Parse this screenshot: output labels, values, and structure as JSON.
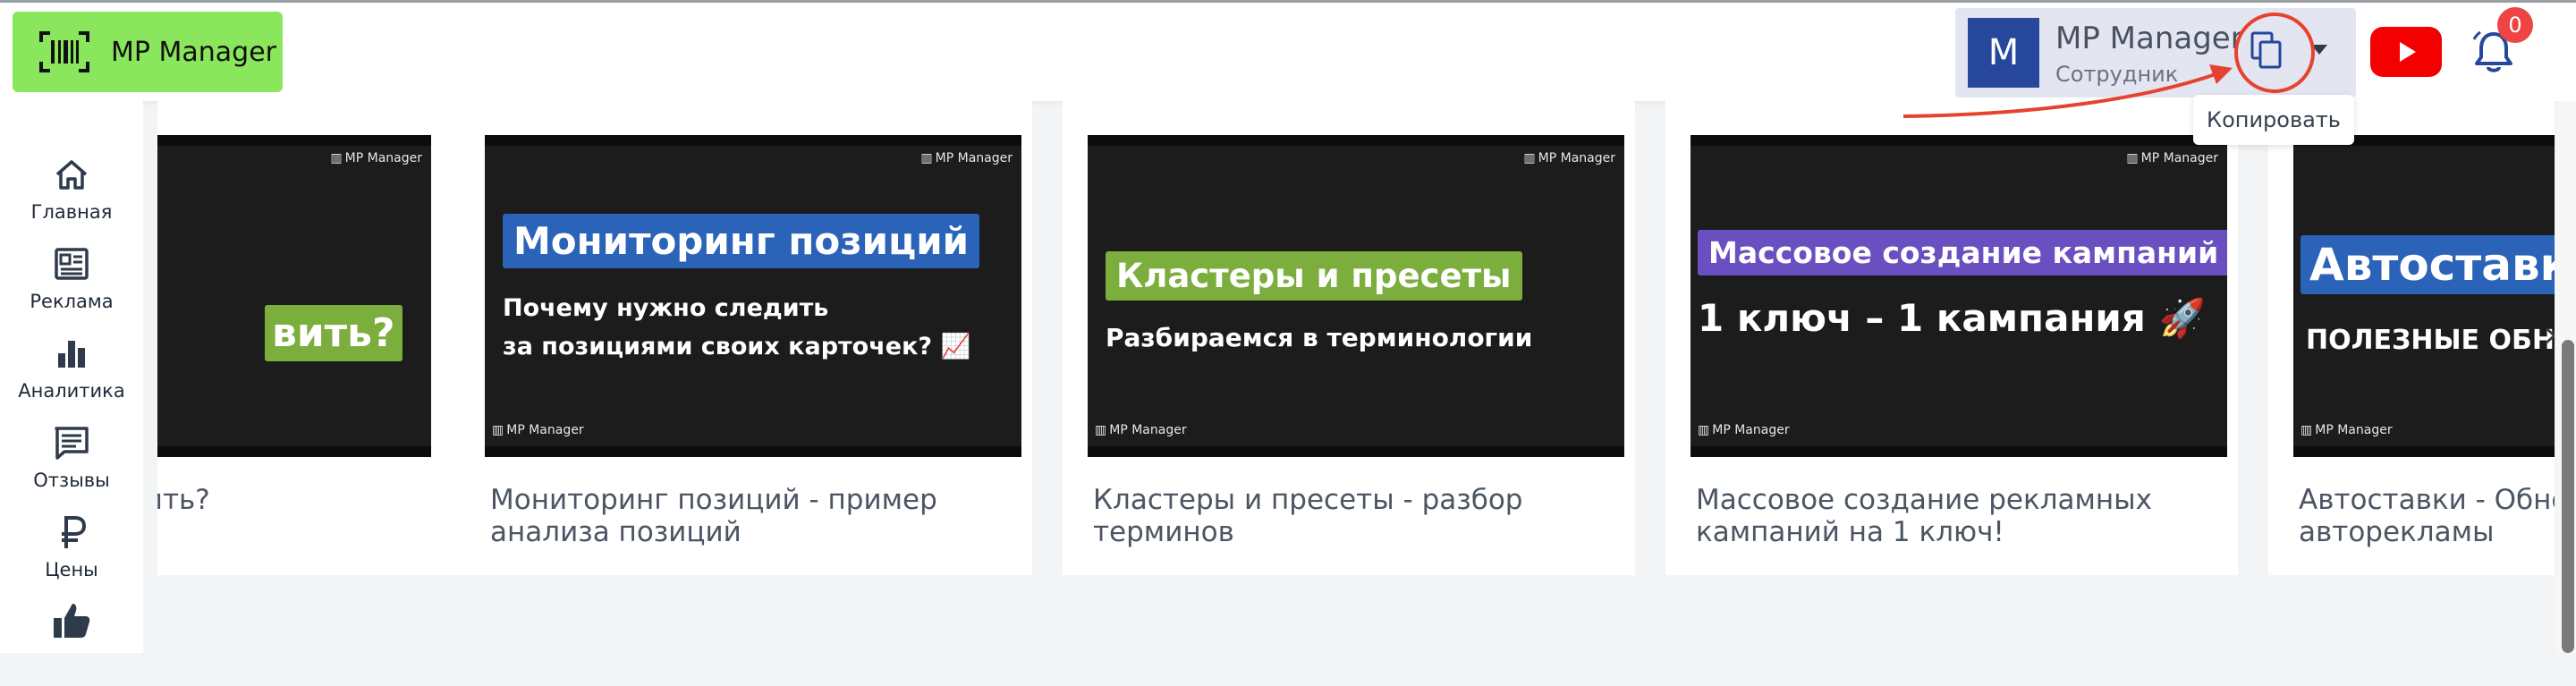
{
  "app": {
    "logo_text": "MP Manager"
  },
  "user": {
    "avatar_letter": "M",
    "name": "MP Manager",
    "role": "Сотрудник"
  },
  "notifications": {
    "count": "0"
  },
  "tooltip": {
    "copy": "Копировать"
  },
  "sidebar": {
    "items": [
      {
        "label": "Главная",
        "icon": "home-icon"
      },
      {
        "label": "Реклама",
        "icon": "ad-icon"
      },
      {
        "label": "Аналитика",
        "icon": "bar-chart-icon"
      },
      {
        "label": "Отзывы",
        "icon": "reviews-icon"
      },
      {
        "label": "Цены",
        "icon": "ruble-icon"
      },
      {
        "label": "",
        "icon": "thumbs-up-icon"
      }
    ]
  },
  "watermark": "MP Manager",
  "cards": [
    {
      "title": "у поставить?",
      "headline": "вить?",
      "subtitle": ""
    },
    {
      "title": "Мониторинг позиций - пример анализа позиций",
      "headline": "Мониторинг позиций",
      "subtitle_line1": "Почему нужно следить",
      "subtitle_line2": "за позициями своих карточек? 📈"
    },
    {
      "title": "Кластеры и пресеты - разбор терминов",
      "headline": "Кластеры и пресеты",
      "subtitle_line1": "Разбираемся в терминологии"
    },
    {
      "title": "Массовое создание рекламных кампаний на 1 ключ!",
      "headline": "Массовое создание кампаний",
      "subtitle_line1": "1 ключ – 1 кампания 🚀"
    },
    {
      "title": "Автоставки - Обно авторекламы",
      "headline": "Автоставки",
      "subtitle_line1": "ПОЛЕЗНЫЕ ОБНО"
    }
  ],
  "colors": {
    "logo_bg": "#8ae65c",
    "avatar_bg": "#26479b",
    "youtube_red": "#f40000",
    "annotation_red": "#e5432f",
    "hl_green": "#7cae3e",
    "hl_blue": "#2a63b8",
    "hl_purple": "#6a4fc0"
  }
}
